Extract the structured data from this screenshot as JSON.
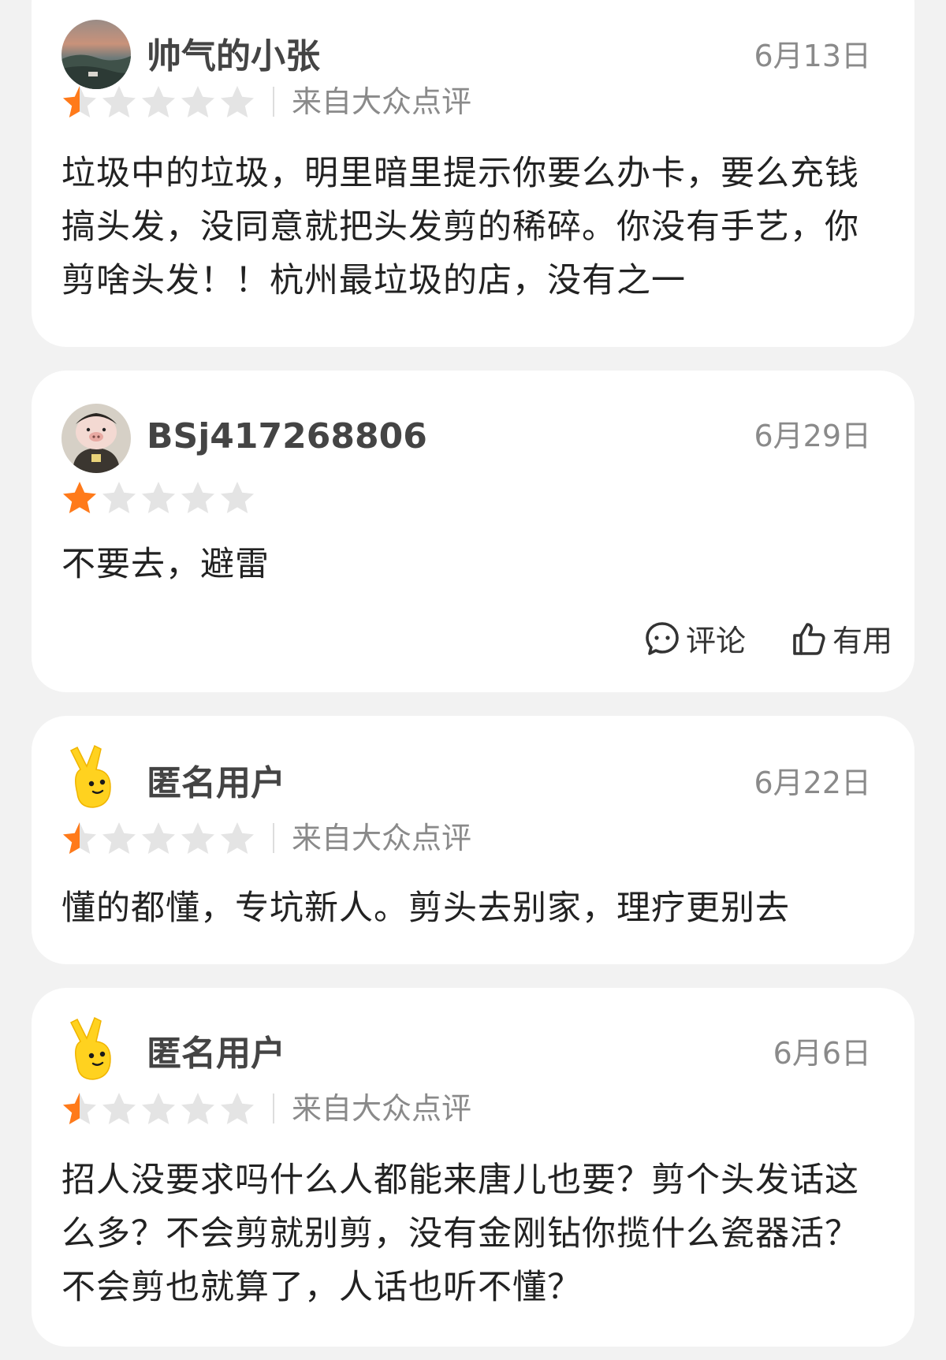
{
  "reviews": [
    {
      "username": "帅气的小张",
      "date": "6月13日",
      "rating": 0.5,
      "source": "来自大众点评",
      "text": "垃圾中的垃圾，明里暗里提示你要么办卡，要么充钱搞头发，没同意就把头发剪的稀碎。你没有手艺，你剪啥头发！！杭州最垃圾的店，没有之一",
      "avatar": "landscape-photo-avatar"
    },
    {
      "username": "BSj417268806",
      "date": "6月29日",
      "rating": 1,
      "text": "不要去，避雷",
      "avatar": "cartoon-pig-avatar",
      "comment_label": "评论",
      "useful_label": "有用"
    },
    {
      "username": "匿名用户",
      "date": "6月22日",
      "rating": 0.5,
      "source": "来自大众点评",
      "text": "懂的都懂，专坑新人。剪头去别家，理疗更别去",
      "avatar": "yellow-mascot-avatar"
    },
    {
      "username": "匿名用户",
      "date": "6月6日",
      "rating": 0.5,
      "source": "来自大众点评",
      "text": "招人没要求吗什么人都能来唐儿也要？剪个头发话这么多？不会剪就别剪，没有金刚钻你揽什么瓷器活？不会剪也就算了，人话也听不懂？",
      "avatar": "yellow-mascot-avatar"
    }
  ],
  "colors": {
    "star_filled": "#ff7a1a",
    "star_empty": "#e4e4e4",
    "page_bg": "#f2f2f2",
    "card_bg": "#ffffff"
  }
}
